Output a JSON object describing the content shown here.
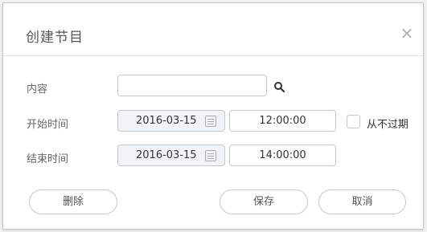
{
  "dialog": {
    "title": "创建节目",
    "close_symbol": "×"
  },
  "form": {
    "content_label": "内容",
    "content_value": "",
    "start_label": "开始时间",
    "start_date": "2016-03-15",
    "start_time": "12:00:00",
    "never_expire_label": "从不过期",
    "never_expire_checked": false,
    "end_label": "结束时间",
    "end_date": "2016-03-15",
    "end_time": "14:00:00"
  },
  "buttons": {
    "delete": "删除",
    "save": "保存",
    "cancel": "取消"
  },
  "icons": {
    "search": "search-icon",
    "calendar": "calendar-icon",
    "close": "close-icon"
  }
}
